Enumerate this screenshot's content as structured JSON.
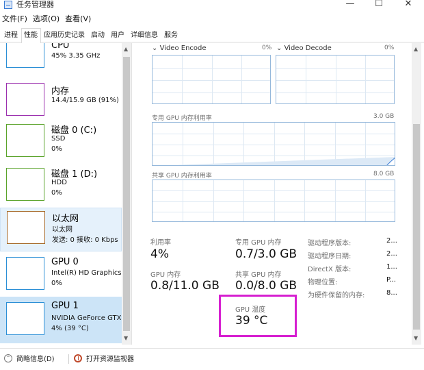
{
  "window": {
    "title": "任务管理器",
    "min": "—",
    "max": "☐",
    "close": "✕"
  },
  "menu": [
    "文件(F)",
    "选项(O)",
    "查看(V)"
  ],
  "tabs": [
    {
      "label": "进程",
      "active": false
    },
    {
      "label": "性能",
      "active": true
    },
    {
      "label": "应用历史记录",
      "active": false
    },
    {
      "label": "启动",
      "active": false
    },
    {
      "label": "用户",
      "active": false
    },
    {
      "label": "详细信息",
      "active": false
    },
    {
      "label": "服务",
      "active": false
    }
  ],
  "sidebar": {
    "items": [
      {
        "title": "CPU",
        "line1": "45% 3.35 GHz",
        "line2": "",
        "color": "#2b8fd6"
      },
      {
        "title": "内存",
        "line1": "14.4/15.9 GB (91%)",
        "line2": "",
        "color": "#9b2fae"
      },
      {
        "title": "磁盘 0 (C:)",
        "line1": "SSD",
        "line2": "0%",
        "color": "#5aa32a"
      },
      {
        "title": "磁盘 1 (D:)",
        "line1": "HDD",
        "line2": "0%",
        "color": "#5aa32a"
      },
      {
        "title": "以太网",
        "line1": "以太网",
        "line2": "发送: 0 接收: 0 Kbps",
        "color": "#a76a2b"
      },
      {
        "title": "GPU 0",
        "line1": "Intel(R) HD Graphics",
        "line2": "0%",
        "color": "#2b8fd6"
      },
      {
        "title": "GPU 1",
        "line1": "NVIDIA GeForce GTX",
        "line2": "4% (39 °C)",
        "color": "#2b8fd6"
      }
    ]
  },
  "graphs": {
    "video_encode": {
      "label": "Video Encode",
      "value": "0%"
    },
    "video_decode": {
      "label": "Video Decode",
      "value": "0%"
    },
    "dedicated": {
      "label": "专用 GPU 内存利用率",
      "max": "3.0 GB"
    },
    "shared": {
      "label": "共享 GPU 内存利用率",
      "max": "8.0 GB"
    }
  },
  "stats": {
    "utilization": {
      "label": "利用率",
      "value": "4%"
    },
    "dedicated_mem": {
      "label": "专用 GPU 内存",
      "value": "0.7/3.0 GB"
    },
    "gpu_mem": {
      "label": "GPU 内存",
      "value": "0.8/11.0 GB"
    },
    "shared_mem": {
      "label": "共享 GPU 内存",
      "value": "0.0/8.0 GB"
    },
    "gpu_temp": {
      "label": "GPU 温度",
      "value": "39 °C"
    }
  },
  "info": [
    {
      "key": "驱动程序版本:",
      "value": "2..."
    },
    {
      "key": "驱动程序日期:",
      "value": "2..."
    },
    {
      "key": "DirectX 版本:",
      "value": "1..."
    },
    {
      "key": "物理位置:",
      "value": "P..."
    },
    {
      "key": "为硬件保留的内存:",
      "value": "8..."
    }
  ],
  "footer": {
    "brief": "简略信息(D)",
    "monitor": "打开资源监视器"
  },
  "colors": {
    "highlight": "#d61fd0",
    "graph_border": "#95b8db",
    "selected_bg": "#cce4f7"
  }
}
